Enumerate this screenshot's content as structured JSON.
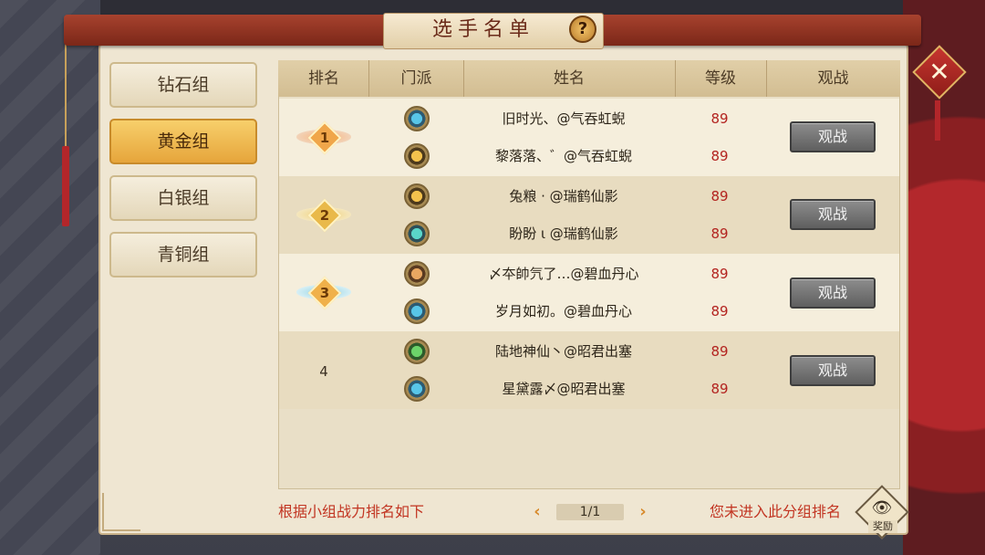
{
  "window": {
    "title": "选手名单",
    "help_label": "?",
    "close_label": "✕"
  },
  "groups": [
    {
      "label": "钻石组",
      "active": false
    },
    {
      "label": "黄金组",
      "active": true
    },
    {
      "label": "白银组",
      "active": false
    },
    {
      "label": "青铜组",
      "active": false
    }
  ],
  "table": {
    "headers": {
      "rank": "排名",
      "sect": "门派",
      "name": "姓名",
      "level": "等级",
      "watch": "观战"
    },
    "ranks": [
      {
        "rank": "1",
        "watch_label": "观战",
        "players": [
          {
            "sect_icon": "cyan-ring-icon",
            "name": "旧时光、@气吞虹蜺",
            "level": "89"
          },
          {
            "sect_icon": "gold-emblem-icon",
            "name": "黎落落、゛@气吞虹蜺",
            "level": "89"
          }
        ]
      },
      {
        "rank": "2",
        "watch_label": "观战",
        "players": [
          {
            "sect_icon": "gold-emblem-icon",
            "name": "兔粮 · @瑞鹤仙影",
            "level": "89"
          },
          {
            "sect_icon": "teal-arrow-icon",
            "name": "盼盼 ι @瑞鹤仙影",
            "level": "89"
          }
        ]
      },
      {
        "rank": "3",
        "watch_label": "观战",
        "players": [
          {
            "sect_icon": "brown-sword-icon",
            "name": "〆夲帥氕了…@碧血丹心",
            "level": "89"
          },
          {
            "sect_icon": "cyan-ring-icon",
            "name": "岁月如初。@碧血丹心",
            "level": "89"
          }
        ]
      },
      {
        "rank": "4",
        "watch_label": "观战",
        "players": [
          {
            "sect_icon": "green-leaf-icon",
            "name": "陆地神仙丶@昭君出塞",
            "level": "89"
          },
          {
            "sect_icon": "cyan-ring-icon",
            "name": "星黛露〆@昭君出塞",
            "level": "89"
          }
        ]
      }
    ]
  },
  "footer": {
    "hint": "根据小组战力排名如下",
    "page": "1/1",
    "prev_label": "‹",
    "next_label": "›",
    "status": "您未进入此分组排名",
    "reward_label": "奖励"
  }
}
